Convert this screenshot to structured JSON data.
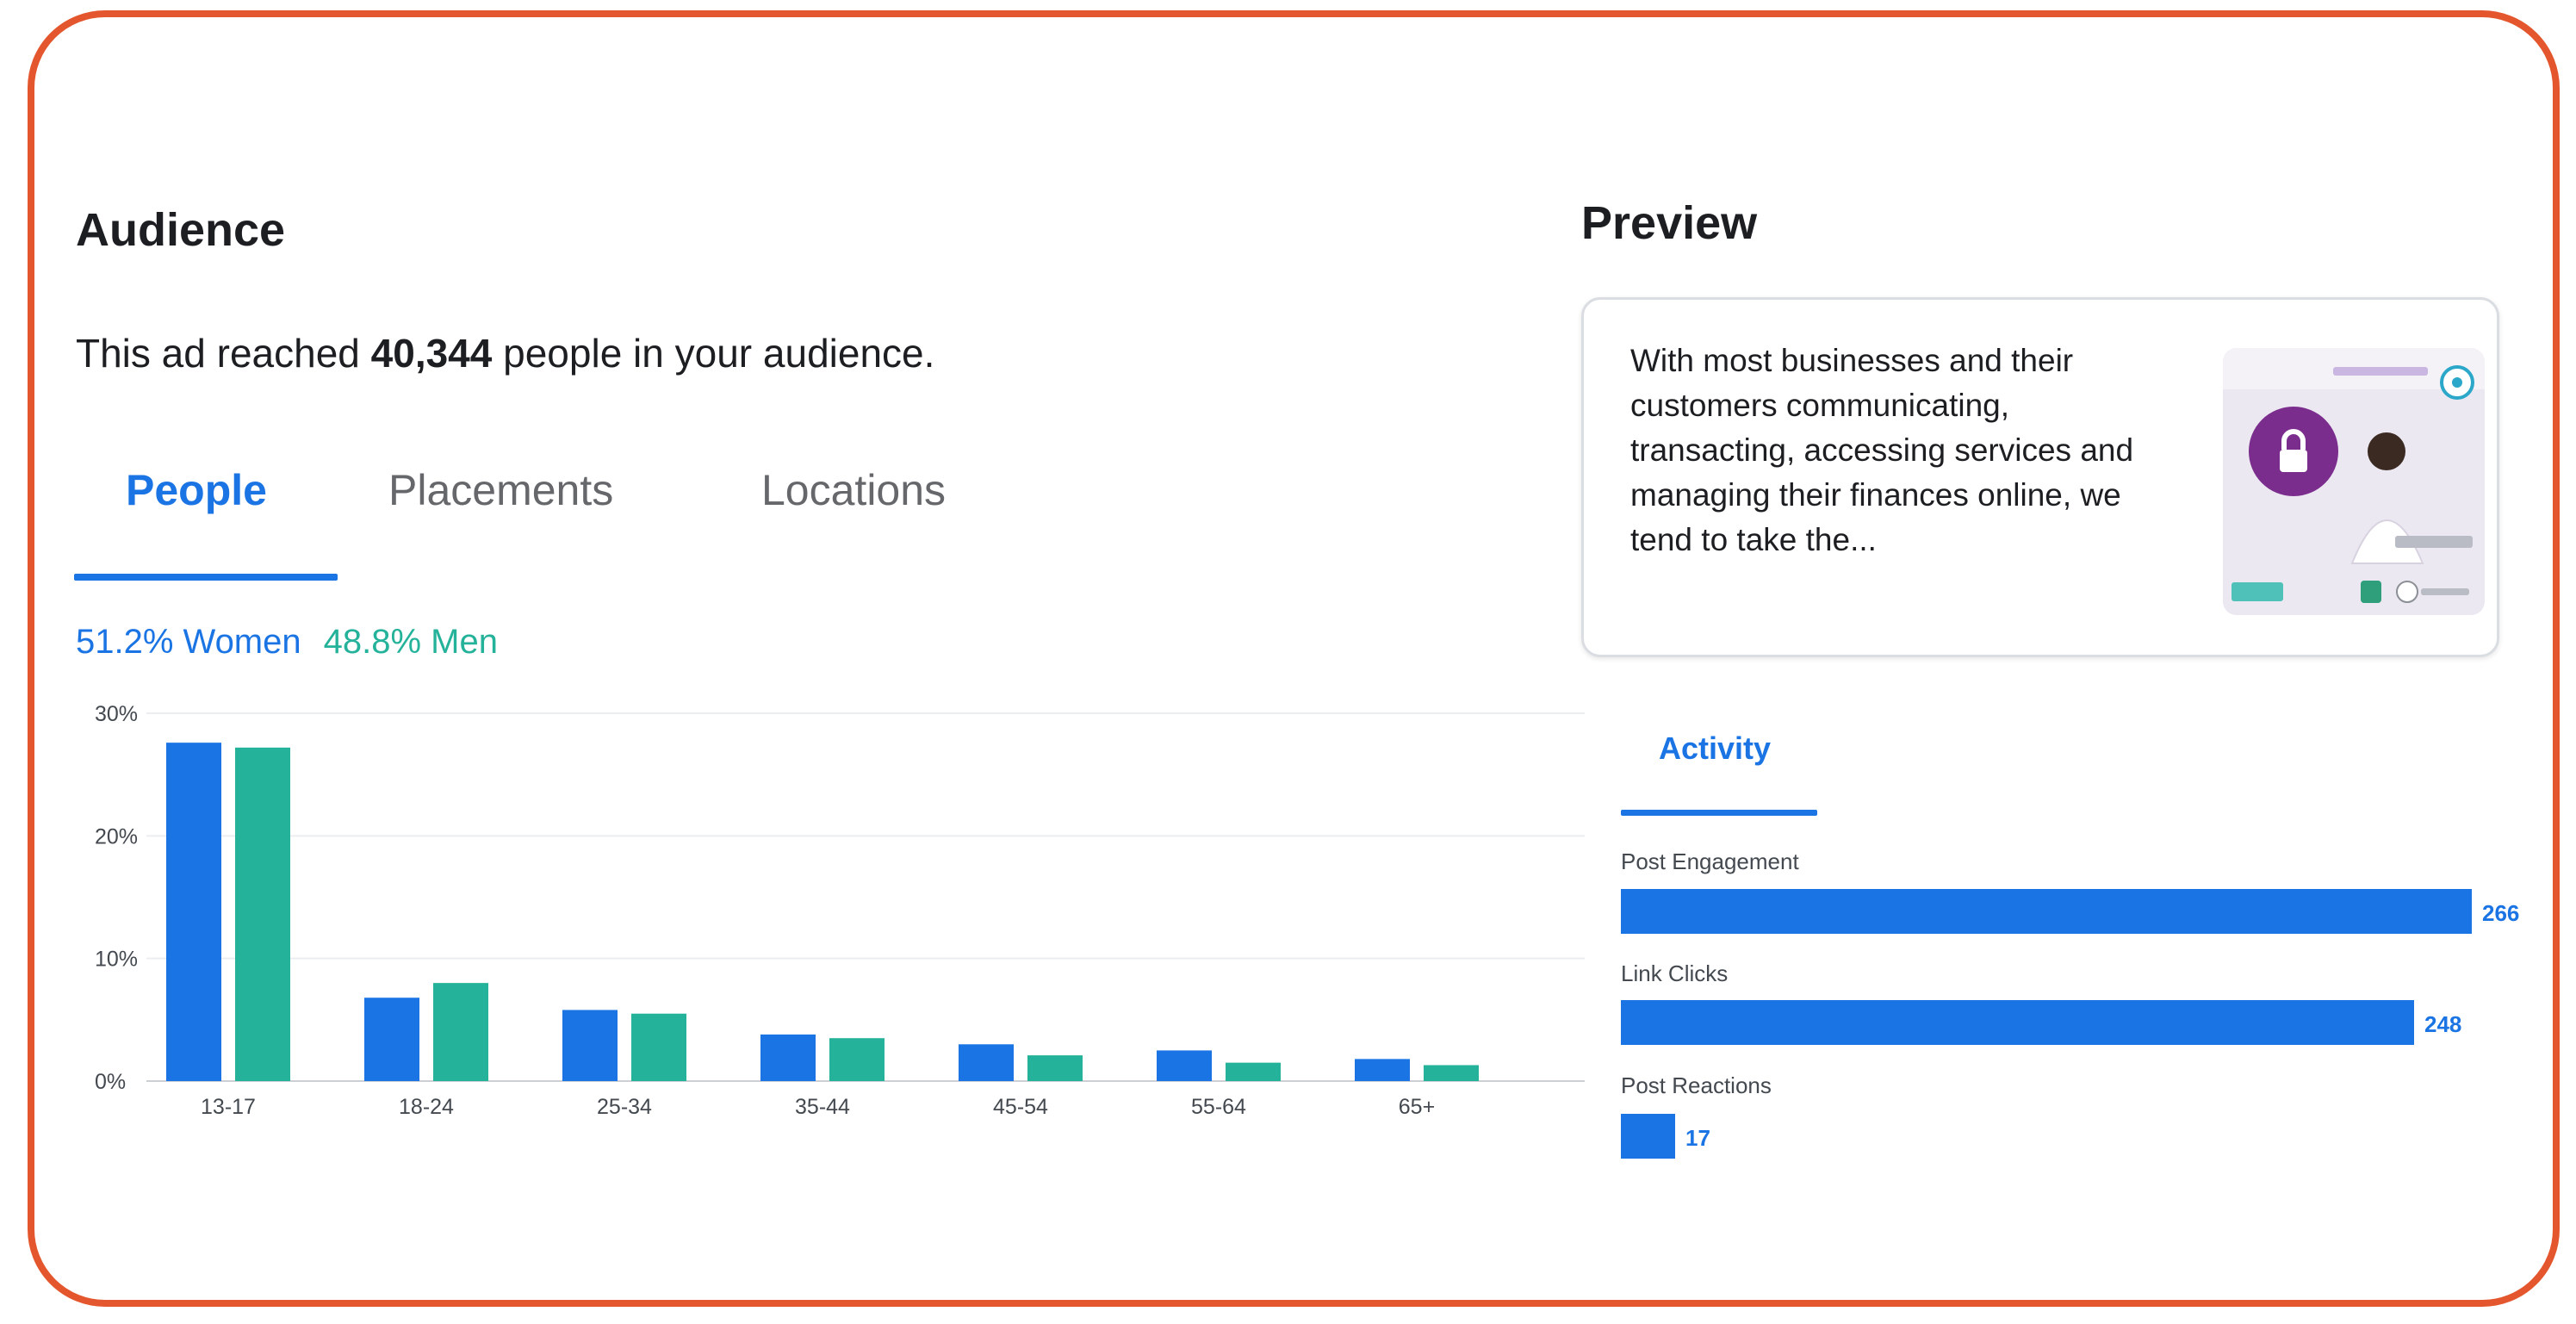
{
  "audience": {
    "title": "Audience",
    "reach_prefix": "This ad reached ",
    "reach_count": "40,344",
    "reach_suffix": " people in your audience.",
    "tabs": [
      {
        "label": "People",
        "active": true
      },
      {
        "label": "Placements",
        "active": false
      },
      {
        "label": "Locations",
        "active": false
      }
    ],
    "women_label": "51.2% Women",
    "men_label": "48.8% Men"
  },
  "colors": {
    "frame": "#e4572e",
    "women": "#1b74e4",
    "men": "#24b29a",
    "accent": "#1b74e4"
  },
  "chart_data": {
    "type": "bar",
    "categories": [
      "13-17",
      "18-24",
      "25-34",
      "35-44",
      "45-54",
      "55-64",
      "65+"
    ],
    "series": [
      {
        "name": "Women",
        "values": [
          27.6,
          6.8,
          5.8,
          3.8,
          3.0,
          2.5,
          1.8
        ]
      },
      {
        "name": "Men",
        "values": [
          27.2,
          8.0,
          5.5,
          3.5,
          2.1,
          1.5,
          1.3
        ]
      }
    ],
    "ylim": [
      0,
      30
    ],
    "yticks": [
      "0%",
      "10%",
      "20%",
      "30%"
    ],
    "grid": true
  },
  "preview": {
    "title": "Preview",
    "text": "With most businesses and their customers communicating, transacting, accessing services and managing their finances online, we tend to take the...",
    "image": "ad-thumbnail-padlock"
  },
  "activity": {
    "tab_label": "Activity",
    "metrics": [
      {
        "label": "Post Engagement",
        "value": 266
      },
      {
        "label": "Link Clicks",
        "value": 248
      },
      {
        "label": "Post Reactions",
        "value": 17
      }
    ]
  }
}
